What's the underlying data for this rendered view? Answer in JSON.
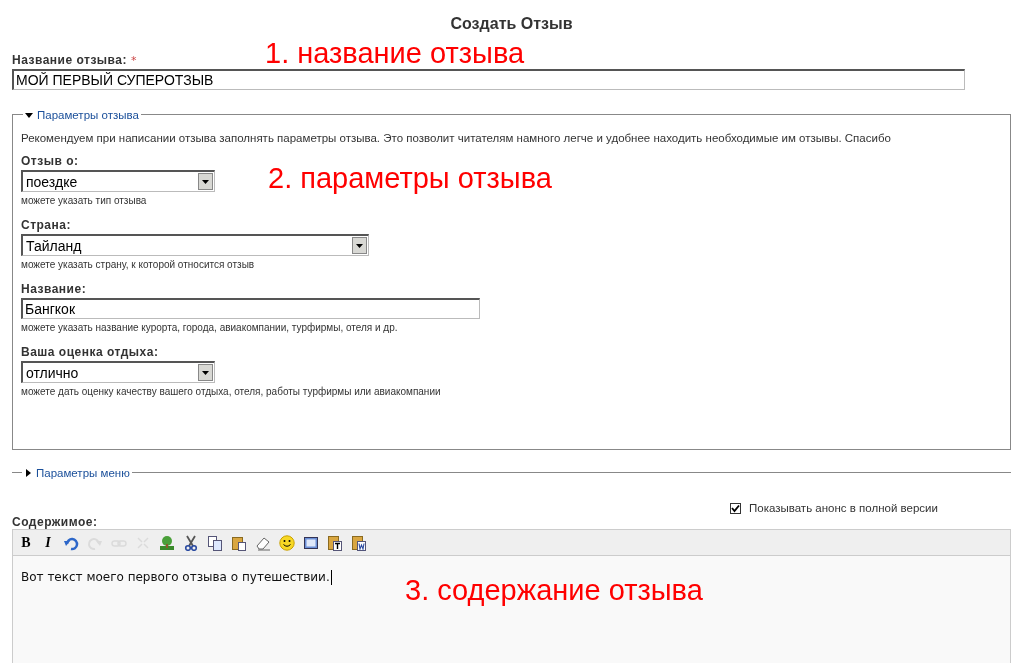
{
  "page_title": "Создать Отзыв",
  "title_field": {
    "label": "Название отзыва:",
    "required_mark": "*",
    "value": "МОЙ ПЕРВЫЙ СУПЕРОТЗЫВ"
  },
  "review_params": {
    "legend": "Параметры отзыва",
    "expanded": true,
    "intro": "Рекомендуем при написании отзыва заполнять параметры отзыва. Это позволит читателям намного легче и удобнее находить необходимые им отзывы. Спасибо",
    "fields": [
      {
        "kind": "select",
        "label": "Отзыв о:",
        "value": "поездке",
        "hint": "можете указать тип отзыва"
      },
      {
        "kind": "select",
        "label": "Страна:",
        "value": "Тайланд",
        "hint": "можете указать страну, к которой относится отзыв"
      },
      {
        "kind": "text",
        "label": "Название:",
        "value": "Бангкок",
        "hint": "можете указать название курорта, города, авиакомпании, турфирмы, отеля и др."
      },
      {
        "kind": "select",
        "label": "Ваша оценка отдыха:",
        "value": "отлично",
        "hint": "можете дать оценку качеству вашего отдыха, отеля, работы турфирмы или авиакомпании"
      }
    ]
  },
  "menu_params": {
    "legend": "Параметры меню",
    "expanded": false
  },
  "teaser_checkbox": {
    "label": "Показывать анонс в полной версии",
    "checked": true
  },
  "content": {
    "label": "Содержимое:",
    "toolbar": [
      {
        "kind": "bold",
        "text": "B",
        "disabled": false
      },
      {
        "kind": "italic",
        "text": "I",
        "disabled": false
      },
      {
        "kind": "undo",
        "disabled": false
      },
      {
        "kind": "redo",
        "disabled": true
      },
      {
        "kind": "link",
        "disabled": true
      },
      {
        "kind": "unlink",
        "disabled": true
      },
      {
        "kind": "image",
        "disabled": false
      },
      {
        "kind": "cut",
        "disabled": false
      },
      {
        "kind": "copy",
        "disabled": false
      },
      {
        "kind": "paste",
        "disabled": false
      },
      {
        "kind": "eraser",
        "disabled": false
      },
      {
        "kind": "smiley",
        "disabled": false
      },
      {
        "kind": "frame",
        "disabled": false
      },
      {
        "kind": "paste_text",
        "disabled": false
      },
      {
        "kind": "paste_word",
        "disabled": false
      }
    ],
    "text": "Вот текст моего первого отзыва о путешествии."
  },
  "annotations": [
    {
      "text": "1. название отзыва"
    },
    {
      "text": "2. параметры отзыва"
    },
    {
      "text": "3. содержание отзыва"
    }
  ]
}
